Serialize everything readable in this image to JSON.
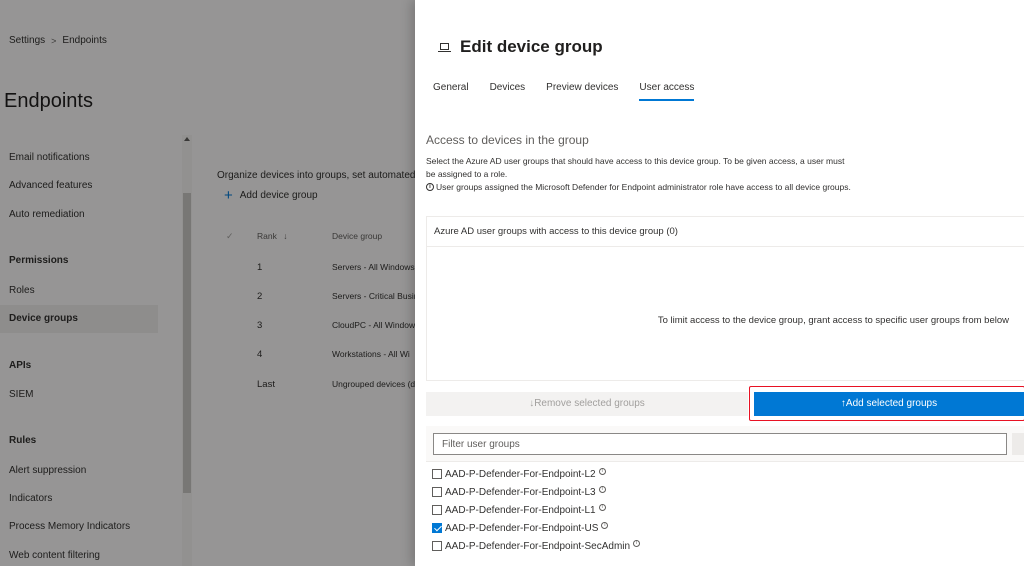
{
  "breadcrumb": {
    "item1": "Settings",
    "separator": ">",
    "item2": "Endpoints"
  },
  "page_title": "Endpoints",
  "left_nav": {
    "email": "Email notifications",
    "advanced": "Advanced features",
    "auto_remediation": "Auto remediation",
    "permissions_header": "Permissions",
    "roles": "Roles",
    "device_groups": "Device groups",
    "apis_header": "APIs",
    "siem": "SIEM",
    "rules_header": "Rules",
    "alert_suppression": "Alert suppression",
    "indicators": "Indicators",
    "process_memory": "Process Memory Indicators",
    "web_content": "Web content filtering"
  },
  "background_content": {
    "description": "Organize devices into groups, set automated",
    "add_group_label": "Add device group",
    "col_rank": "Rank",
    "col_rank_sort": "↓",
    "col_group": "Device group",
    "check_head": "✓",
    "rows": [
      {
        "rank": "1",
        "name": "Servers - All Windows"
      },
      {
        "rank": "2",
        "name": "Servers - Critical Busin"
      },
      {
        "rank": "3",
        "name": "CloudPC - All Window"
      },
      {
        "rank": "4",
        "name": "Workstations - All Wi"
      },
      {
        "rank": "Last",
        "name": "Ungrouped devices (d"
      }
    ]
  },
  "panel": {
    "title": "Edit device group",
    "tabs": {
      "general": "General",
      "devices": "Devices",
      "preview": "Preview devices",
      "user_access": "User access"
    },
    "section_title": "Access to devices in the group",
    "desc_line1": "Select the Azure AD user groups that should have access to this device group. To be given access, a user must be assigned to a role.",
    "desc_line2": "User groups assigned the Microsoft Defender for Endpoint administrator role have access to all device groups.",
    "groups_header": "Azure AD user groups with access to this device group (0)",
    "groups_empty": "To limit access to the device group, grant access to specific user groups from below",
    "remove_button": "↓Remove selected groups",
    "add_button": "↑Add selected groups",
    "filter_placeholder": "Filter user groups",
    "user_groups": [
      {
        "label": "AAD-P-Defender-For-Endpoint-L2",
        "checked": false
      },
      {
        "label": "AAD-P-Defender-For-Endpoint-L3",
        "checked": false
      },
      {
        "label": "AAD-P-Defender-For-Endpoint-L1",
        "checked": false
      },
      {
        "label": "AAD-P-Defender-For-Endpoint-US",
        "checked": true
      },
      {
        "label": "AAD-P-Defender-For-Endpoint-SecAdmin",
        "checked": false
      }
    ]
  },
  "colors": {
    "accent": "#0078d4",
    "highlight_border": "#e81123"
  },
  "icons": {
    "device": "laptop-icon",
    "info": "info-icon",
    "add": "plus-icon",
    "breadcrumb_sep": "chevron-right-icon"
  }
}
